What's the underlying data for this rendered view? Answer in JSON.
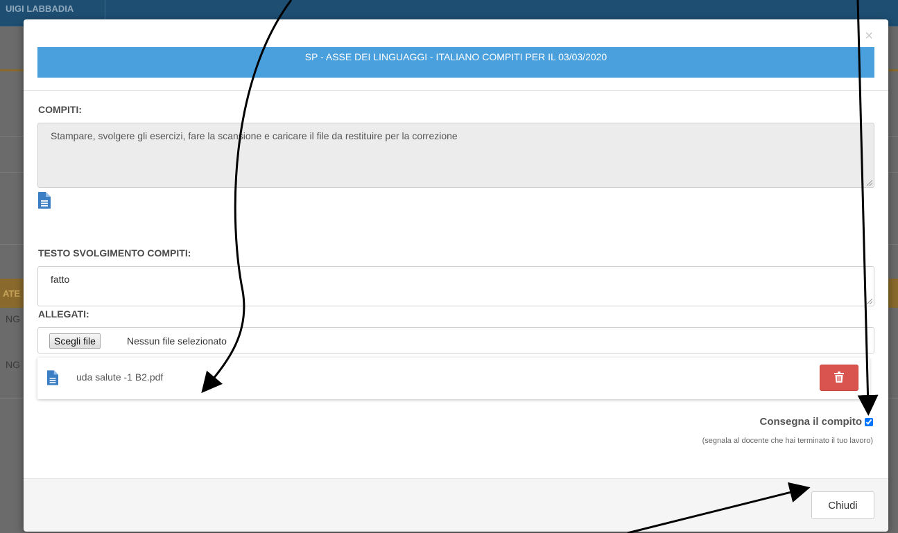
{
  "background": {
    "user_name": "UIGI LABBADIA",
    "row_fragment_1": "NG",
    "row_fragment_2": "NG",
    "header_fragment": "ATE"
  },
  "modal": {
    "close_glyph": "×",
    "title": "SP - ASSE DEI LINGUAGGI - ITALIANO COMPITI PER IL 03/03/2020",
    "compiti_label": "COMPITI:",
    "compiti_text": "Stampare, svolgere gli esercizi, fare la scansione e caricare il file da restituire per la correzione",
    "doc_icon": "file-text-icon",
    "svolgimento_label": "TESTO SVOLGIMENTO COMPITI:",
    "svolgimento_value": "fatto",
    "allegati_label": "ALLEGATI:",
    "file_button_label": "Scegli file",
    "file_status": "Nessun file selezionato",
    "attachments": [
      {
        "name": "uda salute -1 B2.pdf",
        "icon": "file-text-icon",
        "delete_icon": "trash-icon"
      }
    ],
    "deliver_label": "Consegna il compito",
    "deliver_checked": true,
    "deliver_hint": "(segnala al docente che hai terminato il tuo lavoro)",
    "close_button_label": "Chiudi"
  },
  "colors": {
    "title_bar": "#4a9fdd",
    "delete_button": "#d9534f",
    "topbar": "#1e4f73"
  }
}
